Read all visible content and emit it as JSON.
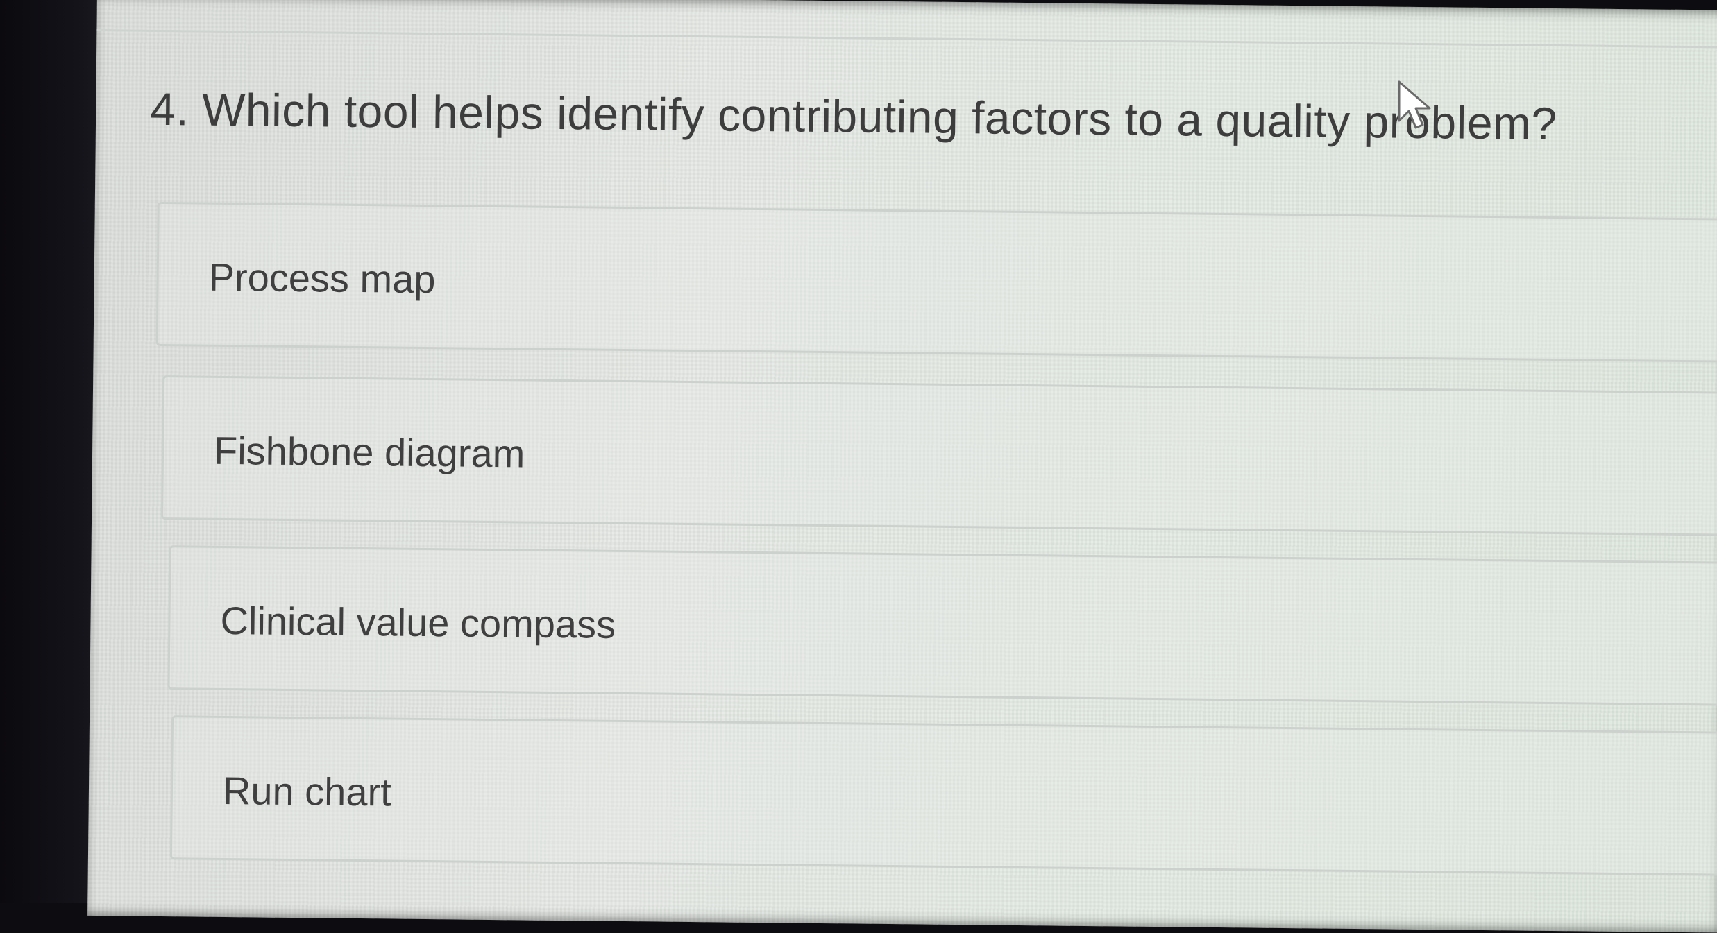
{
  "question": {
    "text": "4. Which tool helps identify contributing factors to a quality problem?"
  },
  "options": [
    {
      "label": "Process map"
    },
    {
      "label": "Fishbone diagram"
    },
    {
      "label": "Clinical value compass"
    },
    {
      "label": "Run chart"
    }
  ],
  "colors": {
    "page_background": "#e4e8e4",
    "text": "#3d3d3d",
    "option_border": "#cdd1cd",
    "bezel": "#0d0c10"
  },
  "icons": {
    "cursor": "mouse-pointer-icon"
  }
}
